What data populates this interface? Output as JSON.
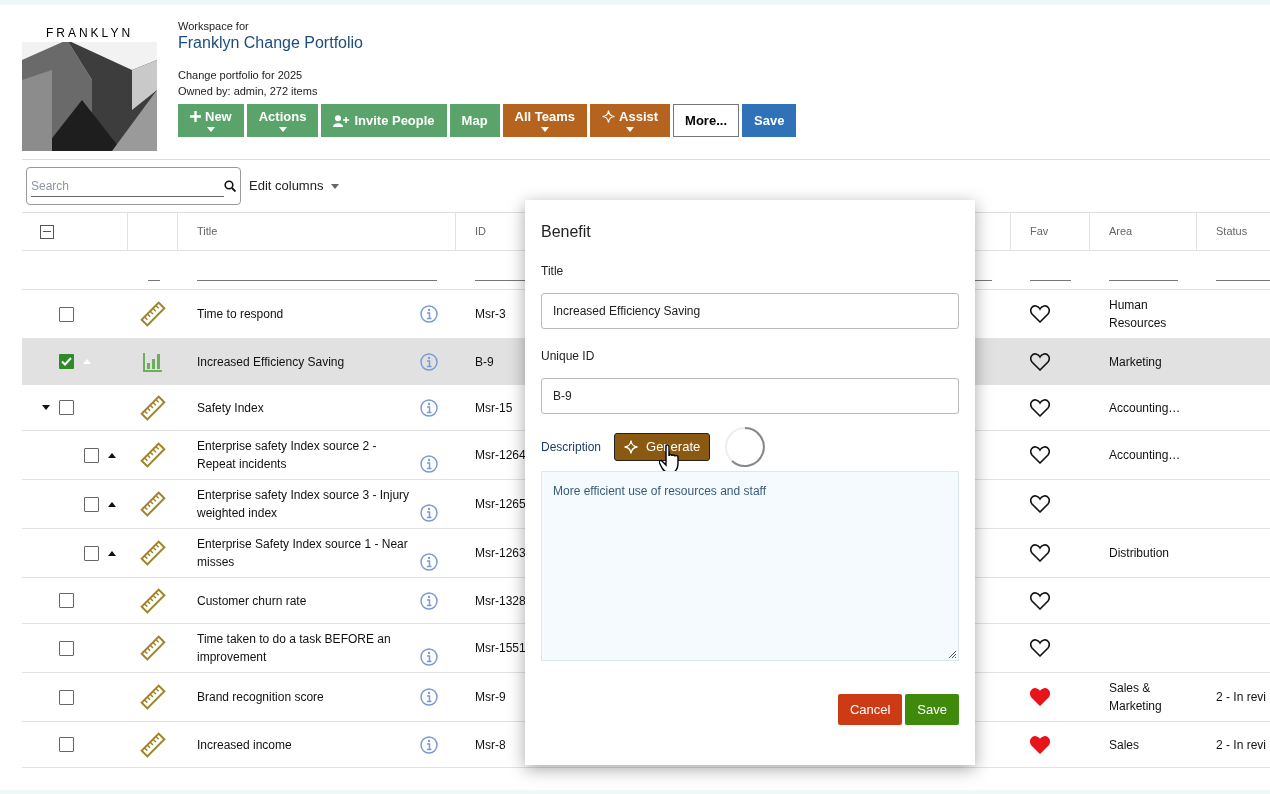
{
  "workspace": {
    "logo_text": "FRANKLYN",
    "caption": "Workspace for",
    "name": "Franklyn Change Portfolio",
    "description": "Change portfolio for 2025",
    "owner": "Owned by: admin, 272 items"
  },
  "toolbar": [
    {
      "label": "New",
      "kind": "green",
      "dropdown": true
    },
    {
      "label": "Actions",
      "kind": "green",
      "dropdown": true
    },
    {
      "label": "Invite People",
      "kind": "green",
      "dropdown": false
    },
    {
      "label": "Map",
      "kind": "green",
      "dropdown": false
    },
    {
      "label": "All Teams",
      "kind": "brown",
      "dropdown": true
    },
    {
      "label": "Assist",
      "kind": "brown",
      "dropdown": true
    },
    {
      "label": "More...",
      "kind": "outline",
      "dropdown": false
    },
    {
      "label": "Save",
      "kind": "blue",
      "dropdown": false
    }
  ],
  "search": {
    "placeholder": "Search"
  },
  "edit_columns": "Edit columns",
  "table": {
    "select_all": {
      "indeterminate": true
    },
    "columns": [
      "Title",
      "ID",
      "Fav",
      "Area",
      "Status"
    ],
    "rows": [
      {
        "title": "Time to respond",
        "id": "Msr-3",
        "kind": "ruler",
        "checked": false,
        "selected": false,
        "handle": false,
        "fav": false,
        "area": "Human Resources"
      },
      {
        "title": "Increased Efficiency Saving",
        "id": "B-9",
        "kind": "chart",
        "checked": true,
        "selected": true,
        "handle": true,
        "fav": false,
        "area": "Marketing"
      },
      {
        "title": "Safety Index",
        "id": "Msr-15",
        "kind": "ruler",
        "checked": false,
        "selected": false,
        "handle": false,
        "expanded": true,
        "fav": false,
        "area": "Accounting…",
        "children": [
          {
            "title": "Enterprise safety Index source 2 - Repeat incidents",
            "id": "Msr-1264",
            "kind": "ruler",
            "checked": false,
            "selected": false,
            "handle": true,
            "fav": false,
            "area": "Accounting…"
          },
          {
            "title": "Enterprise safety Index source 3 - Injury weighted index",
            "id": "Msr-1265",
            "kind": "ruler",
            "checked": false,
            "selected": false,
            "handle": true,
            "fav": false
          },
          {
            "title": "Enterprise Safety Index source 1 - Near misses",
            "id": "Msr-1263",
            "kind": "ruler",
            "checked": false,
            "selected": false,
            "handle": true,
            "fav": false,
            "area": "Distribution"
          }
        ]
      },
      {
        "title": "Customer churn rate",
        "id": "Msr-1328",
        "kind": "ruler",
        "checked": false,
        "selected": false,
        "handle": false,
        "fav": false
      },
      {
        "title": "Time taken to do a task BEFORE an improvement",
        "id": "Msr-1551",
        "kind": "ruler",
        "checked": false,
        "selected": false,
        "handle": false,
        "fav": false
      },
      {
        "title": "Brand recognition score",
        "id": "Msr-9",
        "kind": "ruler",
        "checked": false,
        "selected": false,
        "handle": false,
        "fav": true,
        "area": "Sales & Marketing",
        "status": "2 - In revi"
      },
      {
        "title": "Increased income",
        "id": "Msr-8",
        "kind": "ruler",
        "checked": false,
        "selected": false,
        "handle": false,
        "fav": true,
        "area": "Sales",
        "status": "2 - In revi"
      }
    ]
  },
  "dialog": {
    "title": "Benefit",
    "fields": [
      {
        "label": "Title",
        "value": "Increased Efficiency Saving"
      },
      {
        "label": "Unique ID",
        "value": "B-9"
      }
    ],
    "description_label": "Description",
    "generate": "Generate",
    "loading": true,
    "description": "More efficient use of resources and staff",
    "buttons": [
      {
        "label": "Cancel",
        "kind": "cancel"
      },
      {
        "label": "Save",
        "kind": "save"
      }
    ]
  }
}
